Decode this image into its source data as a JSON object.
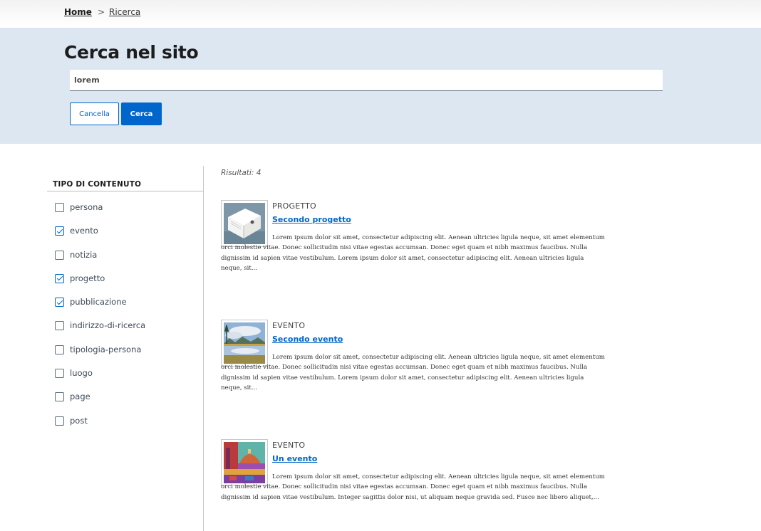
{
  "breadcrumb": {
    "home": "Home",
    "separator": ">",
    "current": "Ricerca"
  },
  "search": {
    "title": "Cerca nel sito",
    "query": "lorem",
    "cancel_label": "Cancella",
    "submit_label": "Cerca"
  },
  "filters": {
    "title": "TIPO DI CONTENUTO",
    "items": [
      {
        "label": "persona",
        "checked": false
      },
      {
        "label": "evento",
        "checked": true
      },
      {
        "label": "notizia",
        "checked": false
      },
      {
        "label": "progetto",
        "checked": true
      },
      {
        "label": "pubblicazione",
        "checked": true
      },
      {
        "label": "indirizzo-di-ricerca",
        "checked": false
      },
      {
        "label": "tipologia-persona",
        "checked": false
      },
      {
        "label": "luogo",
        "checked": false
      },
      {
        "label": "page",
        "checked": false
      },
      {
        "label": "post",
        "checked": false
      }
    ]
  },
  "results": {
    "count_text": "Risultati: 4",
    "items": [
      {
        "type": "PROGETTO",
        "title": "Secondo progetto",
        "thumbnail": "book-image",
        "excerpt": "Lorem ipsum dolor sit amet, consectetur adipiscing elit. Aenean ultricies ligula neque, sit amet elementum orci molestie vitae. Donec sollicitudin nisi vitae egestas accumsan. Donec eget quam et nibh maximus faucibus. Nulla dignissim id sapien vitae vestibulum. Lorem ipsum dolor sit amet, consectetur adipiscing elit. Aenean ultricies ligula neque, sit..."
      },
      {
        "type": "EVENTO",
        "title": "Secondo evento",
        "thumbnail": "lake-landscape-image",
        "excerpt": "Lorem ipsum dolor sit amet, consectetur adipiscing elit. Aenean ultricies ligula neque, sit amet elementum orci molestie vitae. Donec sollicitudin nisi vitae egestas accumsan. Donec eget quam et nibh maximus faucibus. Nulla dignissim id sapien vitae vestibulum. Lorem ipsum dolor sit amet, consectetur adipiscing elit. Aenean ultricies ligula neque, sit..."
      },
      {
        "type": "EVENTO",
        "title": "Un evento",
        "thumbnail": "florence-cathedral-image",
        "excerpt": "Lorem ipsum dolor sit amet, consectetur adipiscing elit. Aenean ultricies ligula neque, sit amet elementum orci molestie vitae. Donec sollicitudin nisi vitae egestas accumsan. Donec eget quam et nibh maximus faucibus. Nulla dignissim id sapien vitae vestibulum. Integer sagittis dolor nisi, ut aliquam neque gravida sed. Fusce nec libero aliquet,..."
      }
    ]
  },
  "colors": {
    "primary": "#0066cc",
    "hero_background": "#dce7f2",
    "text": "#1c1c1c"
  }
}
